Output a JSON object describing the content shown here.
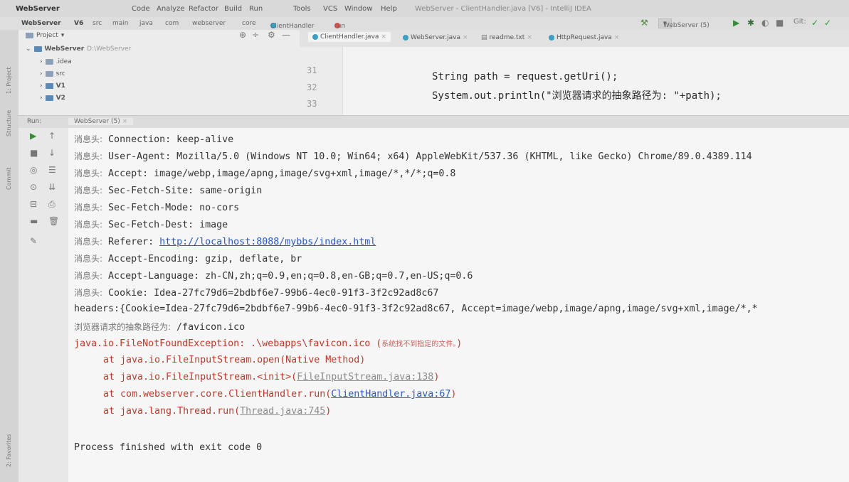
{
  "menubar": {
    "project_name": "WebServer",
    "items": [
      "Code",
      "Analyze",
      "Refactor",
      "Build",
      "Run",
      "Tools",
      "VCS",
      "Window",
      "Help"
    ],
    "window_title": "WebServer - ClientHandler.java [V6] - IntelliJ IDEA"
  },
  "navbar": {
    "breadcrumb": [
      "WebServer",
      "V6",
      "src",
      "main",
      "java",
      "com",
      "webserver",
      "core",
      "ClientHandler",
      "run"
    ]
  },
  "toolbar": {
    "run_config": "WebServer (5)"
  },
  "project_panel": {
    "title": "Project",
    "root_name": "WebServer",
    "root_path": "D:\\WebServer",
    "items": [
      ".idea",
      "src",
      "V1",
      "V2"
    ]
  },
  "editor": {
    "tabs": [
      "ClientHandler.java",
      "WebServer.java",
      "readme.txt",
      "HttpRequest.java"
    ],
    "lines": [
      {
        "num": "31",
        "code": "String path = request.getUri();"
      },
      {
        "num": "32",
        "code": "System.out.println(\"浏览器请求的抽象路径为: \"+path);"
      },
      {
        "num": "33",
        "code": ""
      }
    ]
  },
  "run_panel": {
    "label": "Run:",
    "tab": "WebServer (5)"
  },
  "left_tabs": [
    "1: Project",
    "Structure",
    "Commit",
    "2: Favorites"
  ],
  "console": {
    "headers": [
      {
        "prefix": "消息头:",
        "text": " Connection: keep-alive"
      },
      {
        "prefix": "消息头:",
        "text": " User-Agent: Mozilla/5.0 (Windows NT 10.0; Win64; x64) AppleWebKit/537.36 (KHTML, like Gecko) Chrome/89.0.4389.114"
      },
      {
        "prefix": "消息头:",
        "text": " Accept: image/webp,image/apng,image/svg+xml,image/*,*/*;q=0.8"
      },
      {
        "prefix": "消息头:",
        "text": " Sec-Fetch-Site: same-origin"
      },
      {
        "prefix": "消息头:",
        "text": " Sec-Fetch-Mode: no-cors"
      },
      {
        "prefix": "消息头:",
        "text": " Sec-Fetch-Dest: image"
      },
      {
        "prefix": "消息头:",
        "text": " Referer: "
      },
      {
        "prefix": "消息头:",
        "text": " Accept-Encoding: gzip, deflate, br"
      },
      {
        "prefix": "消息头:",
        "text": " Accept-Language: zh-CN,zh;q=0.9,en;q=0.8,en-GB;q=0.7,en-US;q=0.6"
      },
      {
        "prefix": "消息头:",
        "text": " Cookie: Idea-27fc79d6=2bdbf6e7-99b6-4ec0-91f3-3f2c92ad8c67"
      }
    ],
    "referer_url": "http://localhost:8088/mybbs/index.html",
    "headers_dump": "headers:{Cookie=Idea-27fc79d6=2bdbf6e7-99b6-4ec0-91f3-3f2c92ad8c67, Accept=image/webp,image/apng,image/svg+xml,image/*,*",
    "path_prefix": "浏览器请求的抽象路径为:",
    "path_value": " /favicon.ico",
    "exception": "java.io.FileNotFoundException: .\\webapps\\favicon.ico (",
    "exception_cn": "系统找不到指定的文件。",
    "exception_end": ")",
    "stack": [
      {
        "text": "at java.io.FileInputStream.open(Native Method)",
        "link": "",
        "close": ""
      },
      {
        "text": "at java.io.FileInputStream.<init>(",
        "link": "FileInputStream.java:138",
        "close": ")"
      },
      {
        "text": "at com.webserver.core.ClientHandler.run(",
        "link": "ClientHandler.java:67",
        "close": ")"
      },
      {
        "text": "at java.lang.Thread.run(",
        "link": "Thread.java:745",
        "close": ")"
      }
    ],
    "exit_message": "Process finished with exit code 0"
  }
}
